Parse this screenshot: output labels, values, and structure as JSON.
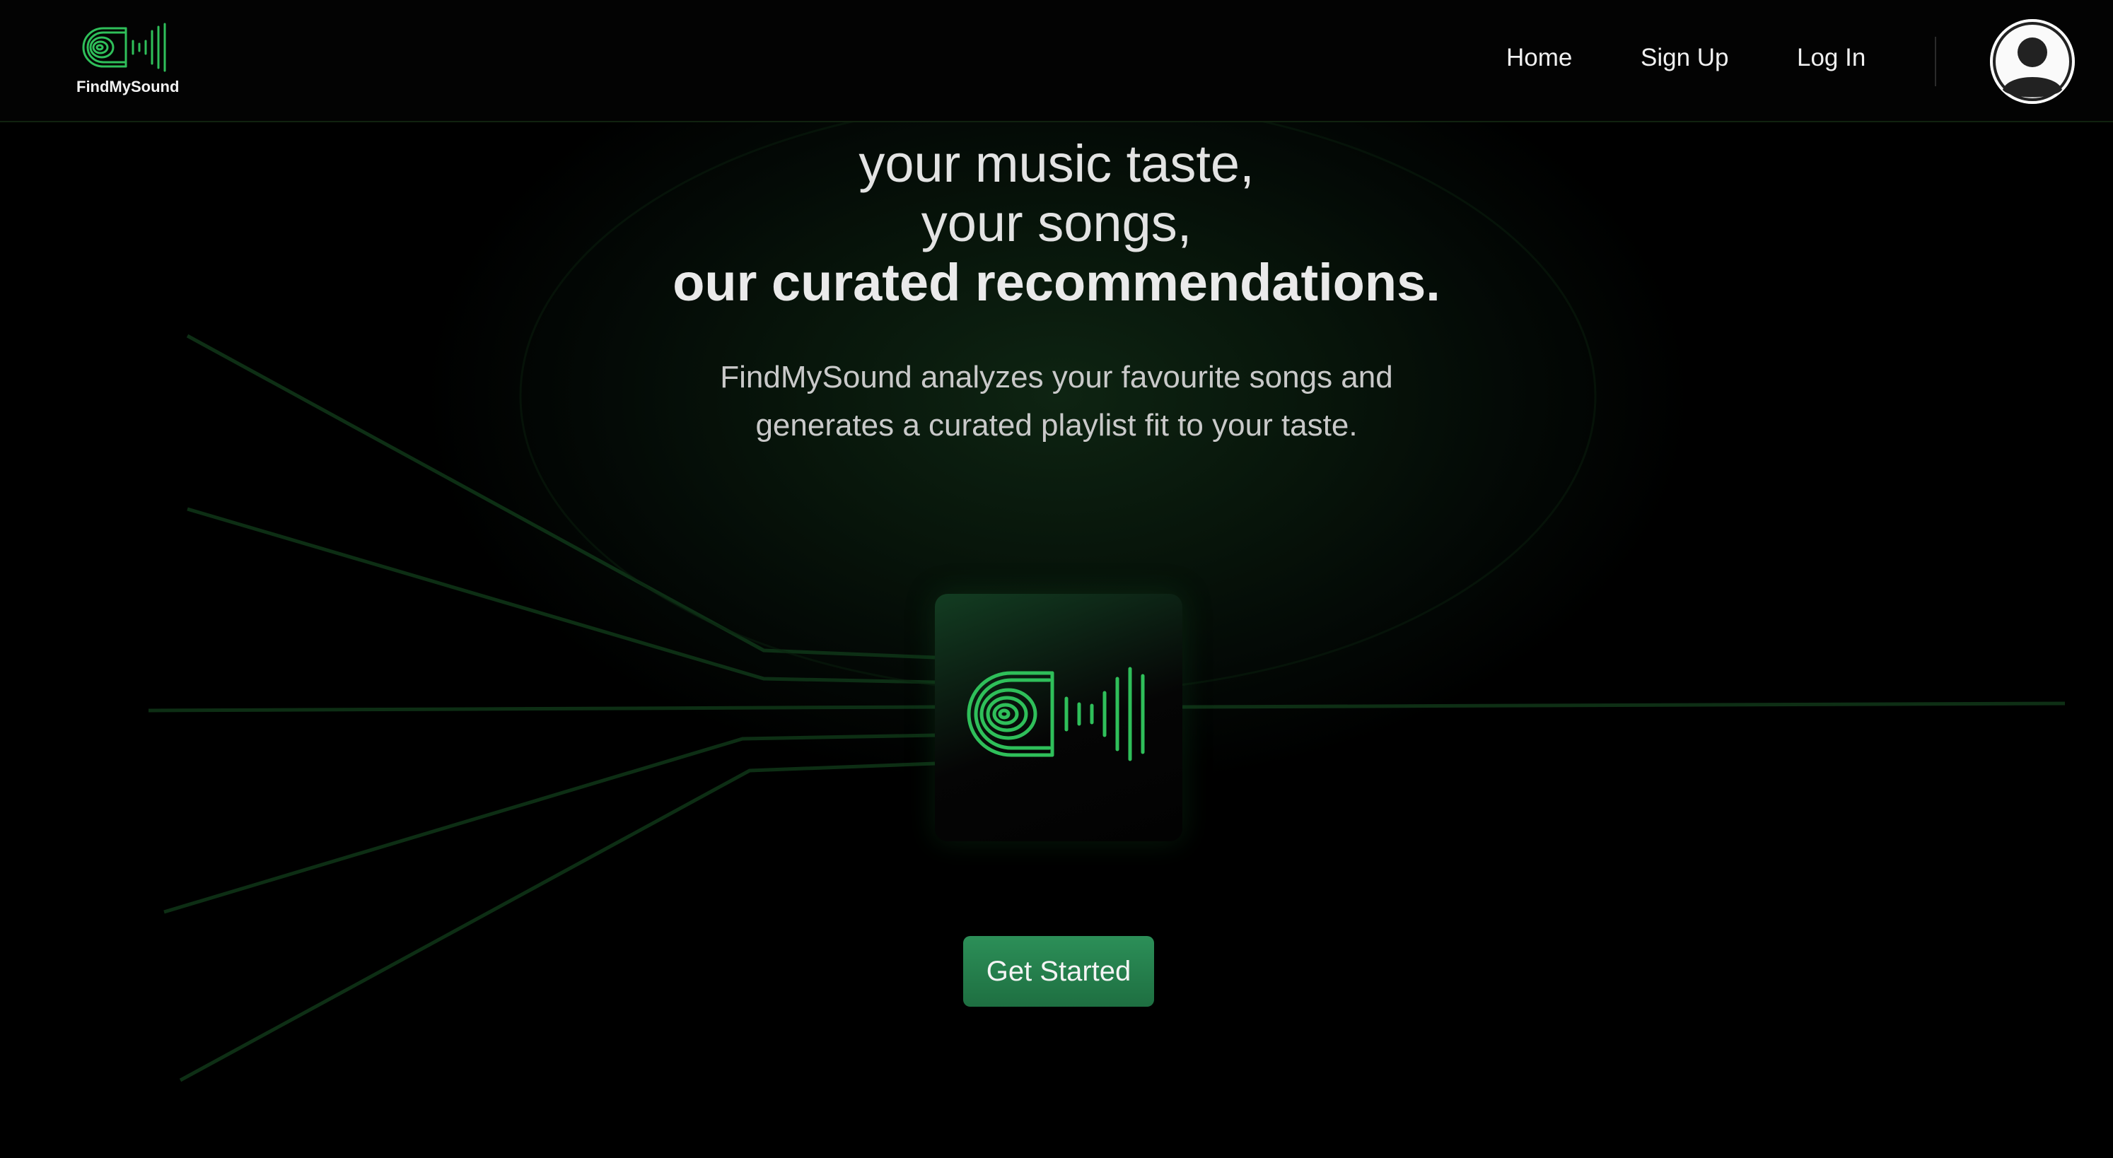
{
  "brand": {
    "name": "FindMySound",
    "logo_icon": "fingerprint-soundwave-logo"
  },
  "nav": {
    "home": "Home",
    "signup": "Sign Up",
    "login": "Log In",
    "avatar_icon": "user-avatar-icon"
  },
  "hero": {
    "line1": "your music taste,",
    "line2": "your songs,",
    "line3": "our curated recommendations.",
    "description_line1": "FindMySound analyzes your favourite songs and",
    "description_line2": "generates a curated playlist fit to your taste."
  },
  "cta": {
    "label": "Get Started"
  },
  "colors": {
    "accent_green": "#2fbf5a",
    "button_green": "#237a4a",
    "background": "#000000"
  }
}
